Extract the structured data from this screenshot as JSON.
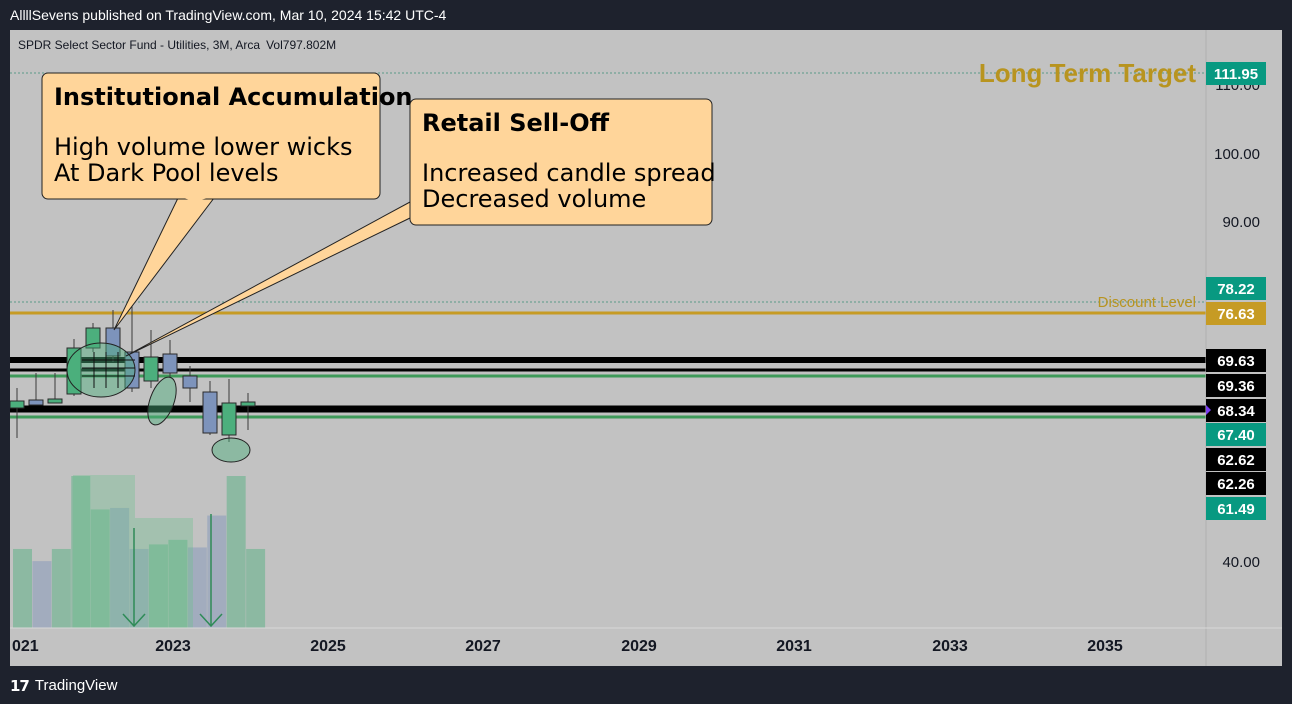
{
  "header": {
    "published_by": "AllllSevens published on TradingView.com, Mar 10, 2024 15:42 UTC-4"
  },
  "footer": {
    "brand": "TradingView"
  },
  "chart_data": {
    "type": "candlestick",
    "title": "SPDR Select Sector Fund - Utilities, 3M, Arca",
    "volume_label": "Vol797.802M",
    "price_axis": {
      "ticks": [
        "110.00",
        "100.00",
        "90.00",
        "40.00"
      ]
    },
    "time_axis": {
      "ticks": [
        "021",
        "2023",
        "2025",
        "2027",
        "2029",
        "2031",
        "2033",
        "2035"
      ]
    },
    "candles": [
      {
        "t": "2021-Q1",
        "o": 67.6,
        "h": 70.6,
        "l": 64.6,
        "c": 67.9
      },
      {
        "t": "2021-Q2",
        "o": 67.9,
        "h": 71.6,
        "l": 67.3,
        "c": 68.5
      },
      {
        "t": "2021-Q3",
        "o": 68.2,
        "h": 68.8,
        "l": 67.8,
        "c": 68.3
      },
      {
        "t": "2021-Q4",
        "o": 67.8,
        "h": 72.6,
        "l": 67.4,
        "c": 71.7
      },
      {
        "t": "2022-Q1",
        "o": 67.7,
        "h": 75.2,
        "l": 66.4,
        "c": 74.9
      },
      {
        "t": "2022-Q2",
        "o": 74.9,
        "h": 77.3,
        "l": 69.7,
        "c": 76.8
      },
      {
        "t": "2022-Q3",
        "o": 76.8,
        "h": 79.5,
        "l": 72.1,
        "c": 72.6
      },
      {
        "t": "2022-Q4",
        "o": 73.2,
        "h": 79.6,
        "l": 68.7,
        "c": 69.5
      },
      {
        "t": "2023-Q1",
        "o": 70.0,
        "h": 72.3,
        "l": 66.0,
        "c": 73.6
      },
      {
        "t": "2023-Q2",
        "o": 73.3,
        "h": 74.6,
        "l": 69.1,
        "c": 70.5
      },
      {
        "t": "2023-Q3",
        "o": 70.5,
        "h": 71.6,
        "l": 68.5,
        "c": 68.8
      },
      {
        "t": "2023-Q4",
        "o": 68.3,
        "h": 70.6,
        "l": 62.0,
        "c": 62.2
      },
      {
        "t": "2024-Q1",
        "o": 62.3,
        "h": 70.4,
        "l": 59.7,
        "c": 67.0
      },
      {
        "t": "2024-Q2",
        "o": 67.4,
        "h": 68.9,
        "l": 63.6,
        "c": 67.6
      }
    ],
    "horizontal_levels": [
      {
        "value": 111.95,
        "label": "111.95",
        "color": "#089981",
        "text_color": "#ffffff",
        "style": "dotted",
        "line_color": "#5b9a88",
        "annotation": "Long Term Target",
        "annotation_color": "#b8941f"
      },
      {
        "value": 78.22,
        "label": "78.22",
        "color": "#089981",
        "text_color": "#ffffff",
        "style": "dotted",
        "line_color": "#5b9a88",
        "annotation": "Discount Level",
        "annotation_color": "#b8941f"
      },
      {
        "value": 76.63,
        "label": "76.63",
        "color": "#c69b24",
        "text_color": "#ffffff",
        "style": "solid",
        "line_color": "#c69b24"
      },
      {
        "value": 69.63,
        "label": "69.63",
        "color": "#000000",
        "text_color": "#ffffff",
        "style": "solid",
        "line_color": "#000000"
      },
      {
        "value": 69.36,
        "label": "69.36",
        "color": "#000000",
        "text_color": "#ffffff",
        "style": "solid",
        "line_color": "#000000"
      },
      {
        "value": 68.34,
        "label": "68.34",
        "color": "#000000",
        "text_color": "#ffffff",
        "style": "solid",
        "line_color": "#1a1a1a"
      },
      {
        "value": 67.4,
        "label": "67.40",
        "color": "#089981",
        "text_color": "#ffffff",
        "style": "solid",
        "line_color": "#3f9a5a"
      },
      {
        "value": 62.62,
        "label": "62.62",
        "color": "#000000",
        "text_color": "#ffffff",
        "style": "solid",
        "line_color": "#000000"
      },
      {
        "value": 62.26,
        "label": "62.26",
        "color": "#000000",
        "text_color": "#ffffff",
        "style": "solid",
        "line_color": "#000000"
      },
      {
        "value": 61.49,
        "label": "61.49",
        "color": "#089981",
        "text_color": "#ffffff",
        "style": "solid",
        "line_color": "#3f9a5a"
      }
    ],
    "volume": [
      {
        "t": "2021-Q1",
        "v": 0.52,
        "up": true
      },
      {
        "t": "2021-Q2",
        "v": 0.44,
        "up": false
      },
      {
        "t": "2021-Q3",
        "v": 0.52,
        "up": true
      },
      {
        "t": "2021-Q4",
        "v": 1.0,
        "up": true
      },
      {
        "t": "2022-Q1",
        "v": 0.78,
        "up": true
      },
      {
        "t": "2022-Q2",
        "v": 0.79,
        "up": false
      },
      {
        "t": "2022-Q3",
        "v": 0.52,
        "up": false
      },
      {
        "t": "2022-Q4",
        "v": 0.55,
        "up": true
      },
      {
        "t": "2023-Q1",
        "v": 0.58,
        "up": true
      },
      {
        "t": "2023-Q2",
        "v": 0.53,
        "up": false
      },
      {
        "t": "2023-Q3",
        "v": 0.74,
        "up": false
      },
      {
        "t": "2023-Q4",
        "v": 1.0,
        "up": true
      },
      {
        "t": "2024-Q1",
        "v": 0.52,
        "up": true
      }
    ],
    "colors": {
      "up": "#4caf7d",
      "down": "#7d93bb",
      "annotation_fill": "#ffd59a"
    },
    "annotations": [
      {
        "title": "Institutional Accumulation",
        "lines": [
          "High volume lower wicks",
          "At Dark Pool levels"
        ]
      },
      {
        "title": "Retail Sell-Off",
        "lines": [
          "Increased candle spread",
          "Decreased volume"
        ]
      }
    ]
  }
}
